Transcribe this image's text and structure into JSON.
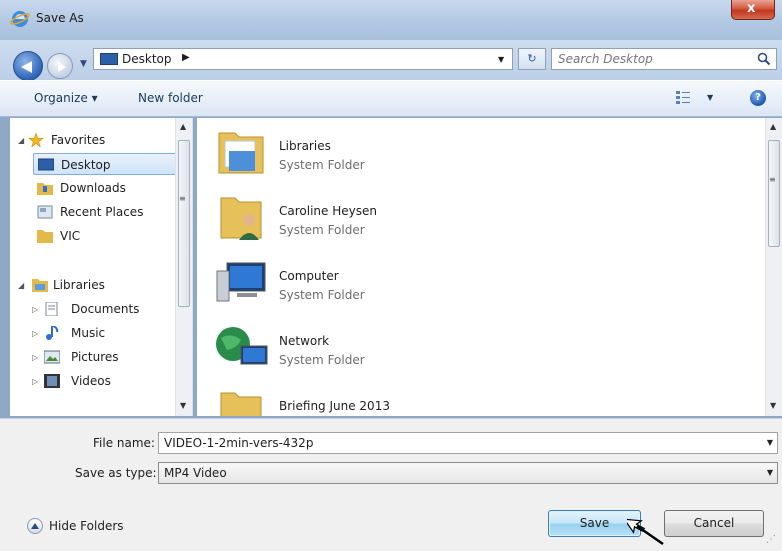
{
  "window": {
    "title": "Save As",
    "close_label": "x"
  },
  "address": {
    "location": "Desktop",
    "search_placeholder": "Search Desktop"
  },
  "toolbar": {
    "organize_label": "Organize ▾",
    "new_folder_label": "New folder",
    "help_label": "?"
  },
  "sidebar": {
    "favorites": {
      "label": "Favorites",
      "items": [
        {
          "label": "Desktop",
          "icon": "desktop-icon",
          "selected": true
        },
        {
          "label": "Downloads",
          "icon": "downloads-folder-icon"
        },
        {
          "label": "Recent Places",
          "icon": "recent-places-icon"
        },
        {
          "label": "VIC",
          "icon": "folder-icon"
        }
      ]
    },
    "libraries": {
      "label": "Libraries",
      "items": [
        {
          "label": "Documents",
          "icon": "documents-icon"
        },
        {
          "label": "Music",
          "icon": "music-icon"
        },
        {
          "label": "Pictures",
          "icon": "pictures-icon"
        },
        {
          "label": "Videos",
          "icon": "videos-icon"
        }
      ]
    }
  },
  "files": [
    {
      "name": "Libraries",
      "type": "System Folder",
      "icon": "libraries-folder-icon"
    },
    {
      "name": "Caroline Heysen",
      "type": "System Folder",
      "icon": "user-folder-icon"
    },
    {
      "name": "Computer",
      "type": "System Folder",
      "icon": "computer-icon"
    },
    {
      "name": "Network",
      "type": "System Folder",
      "icon": "network-icon"
    },
    {
      "name": "Briefing June 2013",
      "type": "",
      "icon": "folder-icon"
    }
  ],
  "form": {
    "file_name_label": "File name:",
    "file_name_value": "VIDEO-1-2min-vers-432p",
    "save_as_type_label": "Save as type:",
    "save_as_type_value": "MP4 Video"
  },
  "footer": {
    "hide_folders_label": "Hide Folders",
    "save_label": "Save",
    "cancel_label": "Cancel"
  },
  "colors": {
    "titlebar": "#b3c8e2",
    "close_button": "#c2371e",
    "save_button": "#98d1ef",
    "selection": "#cfe3fa"
  }
}
